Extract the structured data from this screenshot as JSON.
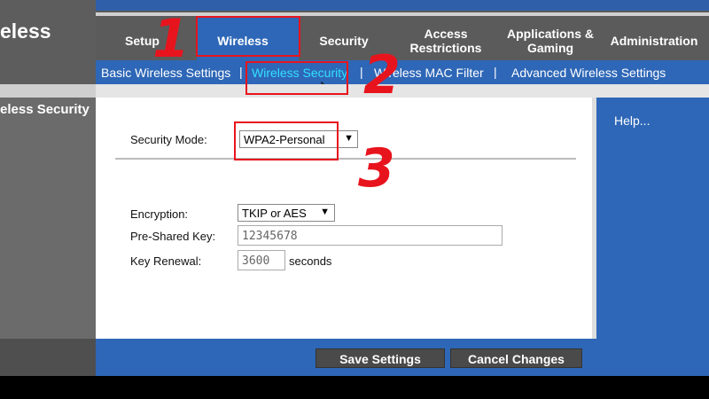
{
  "left": {
    "title": "eless",
    "section": "eless Security"
  },
  "nav": {
    "tabs": [
      {
        "label": "Setup"
      },
      {
        "label": "Wireless"
      },
      {
        "label": "Security"
      },
      {
        "label": "Access Restrictions"
      },
      {
        "label": "Applications & Gaming"
      },
      {
        "label": "Administration"
      }
    ]
  },
  "subnav": {
    "items": [
      "Basic Wireless Settings",
      "Wireless Security",
      "Wireless MAC Filter",
      "Advanced Wireless Settings"
    ],
    "separator": "|"
  },
  "form": {
    "security_mode_label": "Security Mode:",
    "security_mode_value": "WPA2-Personal",
    "encryption_label": "Encryption:",
    "encryption_value": "TKIP or AES",
    "psk_label": "Pre-Shared Key:",
    "psk_value": "12345678",
    "renewal_label": "Key Renewal:",
    "renewal_value": "3600",
    "renewal_unit": "seconds",
    "dropdown_arrow": "▼"
  },
  "help": {
    "label": "Help..."
  },
  "buttons": {
    "save": "Save Settings",
    "cancel": "Cancel Changes"
  },
  "annotations": {
    "n1": "1",
    "n2": "2",
    "n3": "3",
    "color": "#e8141d"
  },
  "colors": {
    "accent_blue": "#2e67b7",
    "subnav_active": "#33e0ff"
  }
}
